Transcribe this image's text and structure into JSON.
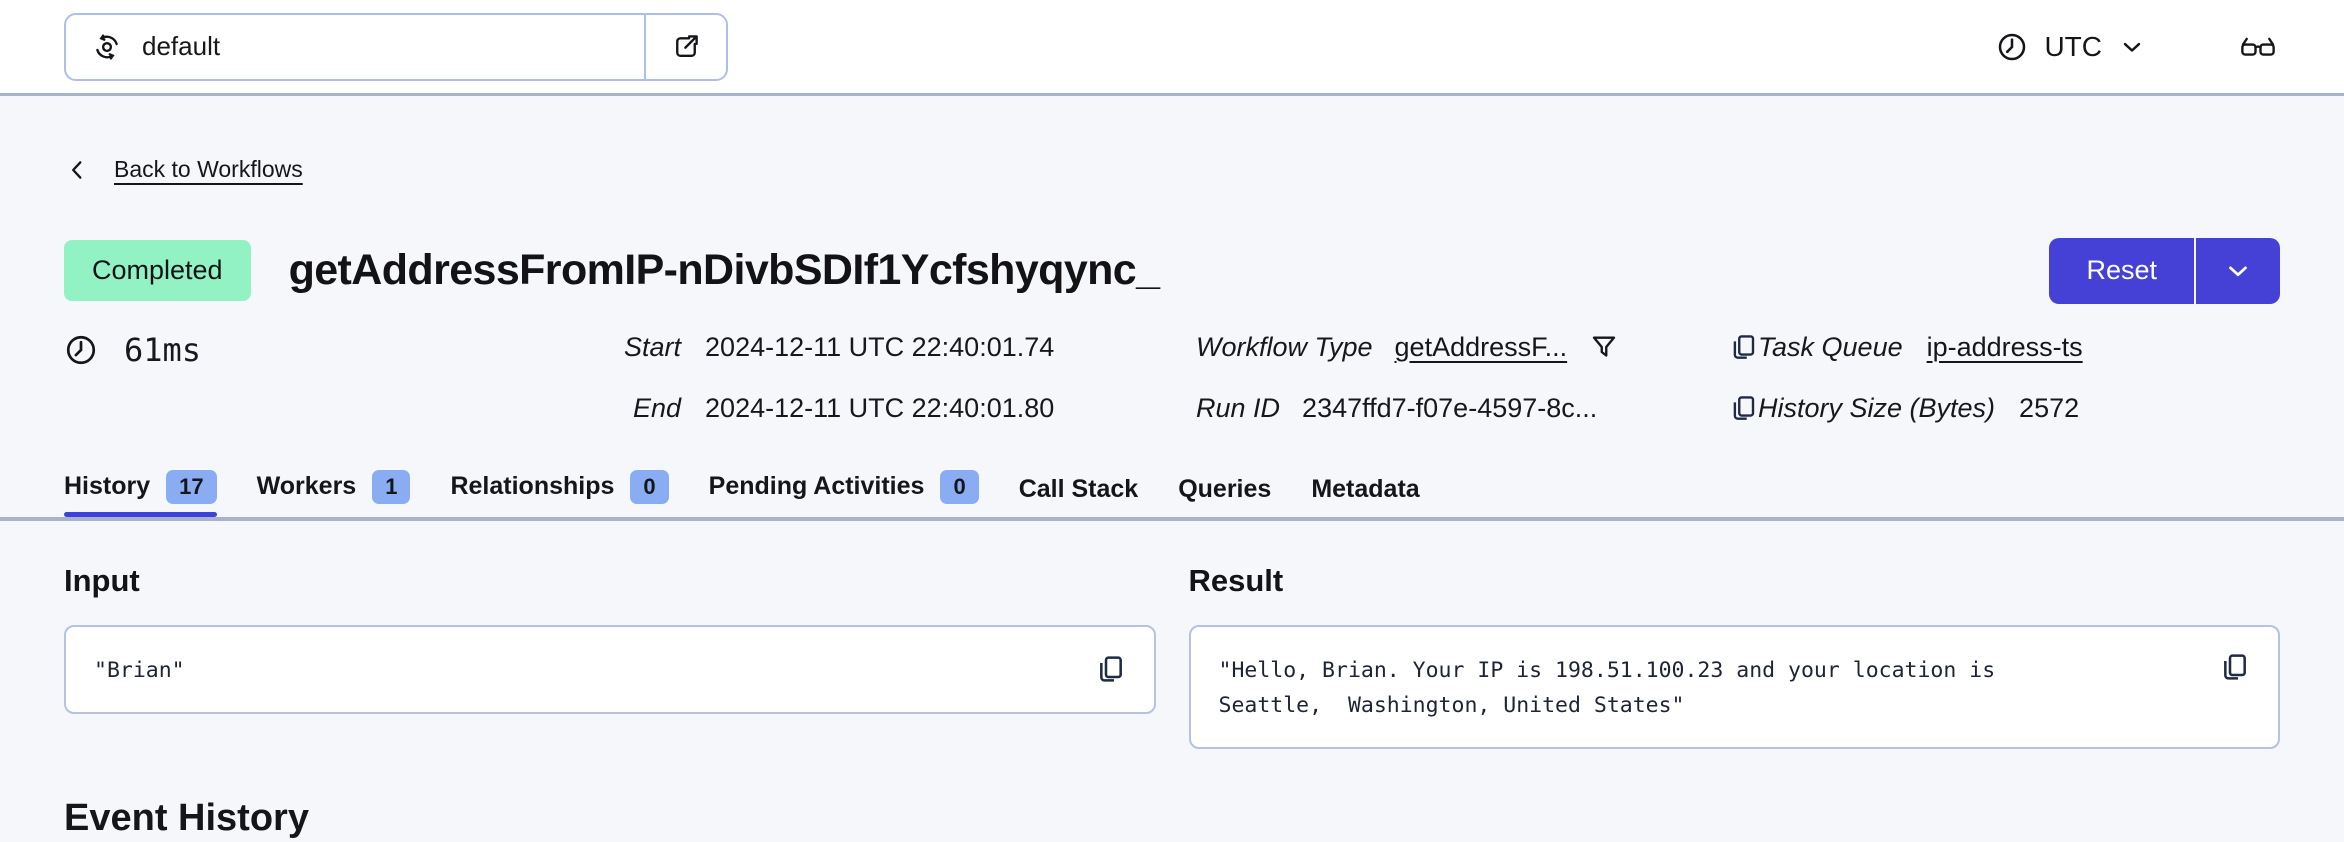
{
  "header": {
    "namespace": {
      "value": "default"
    },
    "timezone": {
      "label": "UTC"
    }
  },
  "nav": {
    "back_label": "Back to Workflows"
  },
  "workflow": {
    "status": "Completed",
    "title": "getAddressFromIP-nDivbSDIf1Ycfshyqync_",
    "reset_label": "Reset",
    "details": {
      "duration": "61ms",
      "start": {
        "label": "Start",
        "value": "2024-12-11 UTC 22:40:01.74"
      },
      "end": {
        "label": "End",
        "value": "2024-12-11 UTC 22:40:01.80"
      },
      "workflow_type": {
        "label": "Workflow Type",
        "value": "getAddressF..."
      },
      "run_id": {
        "label": "Run ID",
        "value": "2347ffd7-f07e-4597-8c..."
      },
      "task_queue": {
        "label": "Task Queue",
        "value": "ip-address-ts"
      },
      "history_size": {
        "label": "History Size (Bytes)",
        "value": "2572"
      }
    }
  },
  "tabs": [
    {
      "label": "History",
      "count": "17"
    },
    {
      "label": "Workers",
      "count": "1"
    },
    {
      "label": "Relationships",
      "count": "0"
    },
    {
      "label": "Pending Activities",
      "count": "0"
    },
    {
      "label": "Call Stack"
    },
    {
      "label": "Queries"
    },
    {
      "label": "Metadata"
    }
  ],
  "io": {
    "input": {
      "heading": "Input",
      "value": "\"Brian\""
    },
    "result": {
      "heading": "Result",
      "value": "\"Hello, Brian. Your IP is 198.51.100.23 and your location is Seattle,  Washington, United States\""
    }
  },
  "sections": {
    "event_history": "Event History"
  },
  "colors": {
    "accent_indigo": "#4641D6",
    "tab_underline": "#3E42DD",
    "status_completed_bg": "#92F2C4",
    "tab_badge_bg": "#8AACF2",
    "divider": "#A9B4CC",
    "box_border": "#B5C2E4",
    "page_bg": "#F6F7FB"
  }
}
